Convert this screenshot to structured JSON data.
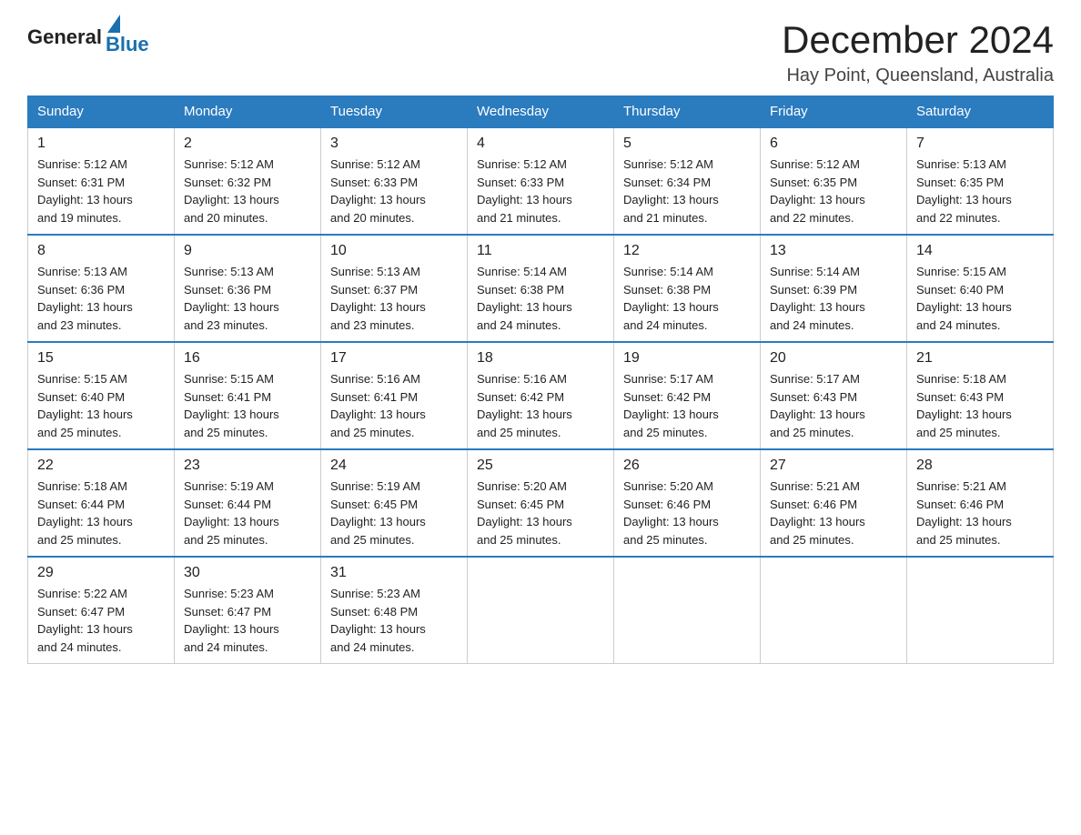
{
  "header": {
    "logo_general": "General",
    "logo_blue": "Blue",
    "month_title": "December 2024",
    "location": "Hay Point, Queensland, Australia"
  },
  "days_of_week": [
    "Sunday",
    "Monday",
    "Tuesday",
    "Wednesday",
    "Thursday",
    "Friday",
    "Saturday"
  ],
  "weeks": [
    [
      {
        "day": "1",
        "sunrise": "5:12 AM",
        "sunset": "6:31 PM",
        "daylight": "13 hours and 19 minutes."
      },
      {
        "day": "2",
        "sunrise": "5:12 AM",
        "sunset": "6:32 PM",
        "daylight": "13 hours and 20 minutes."
      },
      {
        "day": "3",
        "sunrise": "5:12 AM",
        "sunset": "6:33 PM",
        "daylight": "13 hours and 20 minutes."
      },
      {
        "day": "4",
        "sunrise": "5:12 AM",
        "sunset": "6:33 PM",
        "daylight": "13 hours and 21 minutes."
      },
      {
        "day": "5",
        "sunrise": "5:12 AM",
        "sunset": "6:34 PM",
        "daylight": "13 hours and 21 minutes."
      },
      {
        "day": "6",
        "sunrise": "5:12 AM",
        "sunset": "6:35 PM",
        "daylight": "13 hours and 22 minutes."
      },
      {
        "day": "7",
        "sunrise": "5:13 AM",
        "sunset": "6:35 PM",
        "daylight": "13 hours and 22 minutes."
      }
    ],
    [
      {
        "day": "8",
        "sunrise": "5:13 AM",
        "sunset": "6:36 PM",
        "daylight": "13 hours and 23 minutes."
      },
      {
        "day": "9",
        "sunrise": "5:13 AM",
        "sunset": "6:36 PM",
        "daylight": "13 hours and 23 minutes."
      },
      {
        "day": "10",
        "sunrise": "5:13 AM",
        "sunset": "6:37 PM",
        "daylight": "13 hours and 23 minutes."
      },
      {
        "day": "11",
        "sunrise": "5:14 AM",
        "sunset": "6:38 PM",
        "daylight": "13 hours and 24 minutes."
      },
      {
        "day": "12",
        "sunrise": "5:14 AM",
        "sunset": "6:38 PM",
        "daylight": "13 hours and 24 minutes."
      },
      {
        "day": "13",
        "sunrise": "5:14 AM",
        "sunset": "6:39 PM",
        "daylight": "13 hours and 24 minutes."
      },
      {
        "day": "14",
        "sunrise": "5:15 AM",
        "sunset": "6:40 PM",
        "daylight": "13 hours and 24 minutes."
      }
    ],
    [
      {
        "day": "15",
        "sunrise": "5:15 AM",
        "sunset": "6:40 PM",
        "daylight": "13 hours and 25 minutes."
      },
      {
        "day": "16",
        "sunrise": "5:15 AM",
        "sunset": "6:41 PM",
        "daylight": "13 hours and 25 minutes."
      },
      {
        "day": "17",
        "sunrise": "5:16 AM",
        "sunset": "6:41 PM",
        "daylight": "13 hours and 25 minutes."
      },
      {
        "day": "18",
        "sunrise": "5:16 AM",
        "sunset": "6:42 PM",
        "daylight": "13 hours and 25 minutes."
      },
      {
        "day": "19",
        "sunrise": "5:17 AM",
        "sunset": "6:42 PM",
        "daylight": "13 hours and 25 minutes."
      },
      {
        "day": "20",
        "sunrise": "5:17 AM",
        "sunset": "6:43 PM",
        "daylight": "13 hours and 25 minutes."
      },
      {
        "day": "21",
        "sunrise": "5:18 AM",
        "sunset": "6:43 PM",
        "daylight": "13 hours and 25 minutes."
      }
    ],
    [
      {
        "day": "22",
        "sunrise": "5:18 AM",
        "sunset": "6:44 PM",
        "daylight": "13 hours and 25 minutes."
      },
      {
        "day": "23",
        "sunrise": "5:19 AM",
        "sunset": "6:44 PM",
        "daylight": "13 hours and 25 minutes."
      },
      {
        "day": "24",
        "sunrise": "5:19 AM",
        "sunset": "6:45 PM",
        "daylight": "13 hours and 25 minutes."
      },
      {
        "day": "25",
        "sunrise": "5:20 AM",
        "sunset": "6:45 PM",
        "daylight": "13 hours and 25 minutes."
      },
      {
        "day": "26",
        "sunrise": "5:20 AM",
        "sunset": "6:46 PM",
        "daylight": "13 hours and 25 minutes."
      },
      {
        "day": "27",
        "sunrise": "5:21 AM",
        "sunset": "6:46 PM",
        "daylight": "13 hours and 25 minutes."
      },
      {
        "day": "28",
        "sunrise": "5:21 AM",
        "sunset": "6:46 PM",
        "daylight": "13 hours and 25 minutes."
      }
    ],
    [
      {
        "day": "29",
        "sunrise": "5:22 AM",
        "sunset": "6:47 PM",
        "daylight": "13 hours and 24 minutes."
      },
      {
        "day": "30",
        "sunrise": "5:23 AM",
        "sunset": "6:47 PM",
        "daylight": "13 hours and 24 minutes."
      },
      {
        "day": "31",
        "sunrise": "5:23 AM",
        "sunset": "6:48 PM",
        "daylight": "13 hours and 24 minutes."
      },
      null,
      null,
      null,
      null
    ]
  ],
  "labels": {
    "sunrise": "Sunrise:",
    "sunset": "Sunset:",
    "daylight": "Daylight:"
  }
}
